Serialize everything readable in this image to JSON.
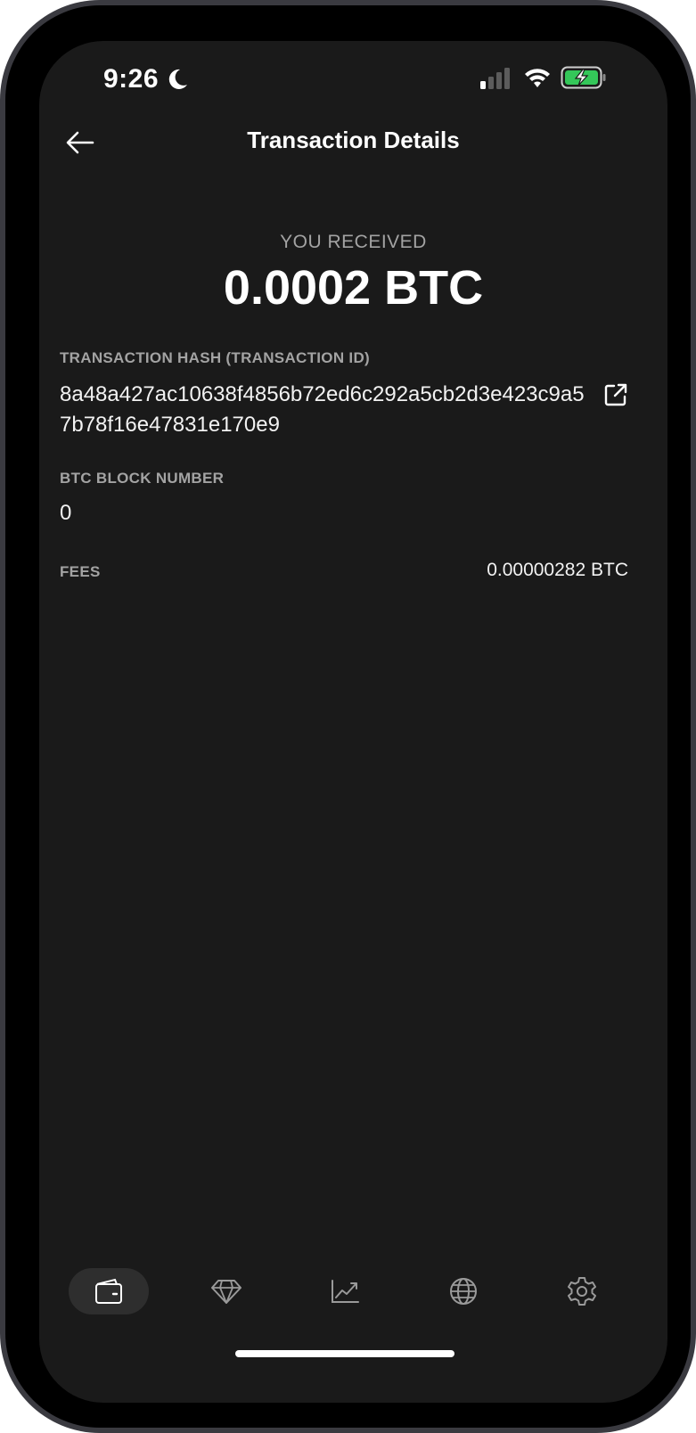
{
  "status_bar": {
    "time": "9:26",
    "moon_icon": "moon-icon",
    "signal_icon": "cellular-signal-icon",
    "wifi_icon": "wifi-icon",
    "battery_icon": "battery-charging-icon",
    "battery_color": "#34c759"
  },
  "header": {
    "back_icon": "arrow-left-icon",
    "title": "Transaction Details"
  },
  "summary": {
    "label": "YOU RECEIVED",
    "amount": "0.0002 BTC"
  },
  "details": {
    "hash_label": "TRANSACTION HASH (TRANSACTION ID)",
    "hash_value": "8a48a427ac10638f4856b72ed6c292a5cb2d3e423c9a57b78f16e47831e170e9",
    "external_link_icon": "external-link-icon",
    "block_label": "BTC BLOCK NUMBER",
    "block_value": "0",
    "fees_label": "FEES",
    "fees_value": "0.00000282 BTC"
  },
  "tab_bar": {
    "tabs": [
      {
        "icon": "wallet-icon",
        "active": true
      },
      {
        "icon": "diamond-icon",
        "active": false
      },
      {
        "icon": "chart-line-icon",
        "active": false
      },
      {
        "icon": "globe-icon",
        "active": false
      },
      {
        "icon": "gear-icon",
        "active": false
      }
    ]
  },
  "colors": {
    "background": "#1a1a1a",
    "text_primary": "#ffffff",
    "text_secondary": "#a3a3a3",
    "active_tab": "#2e2e2e"
  }
}
